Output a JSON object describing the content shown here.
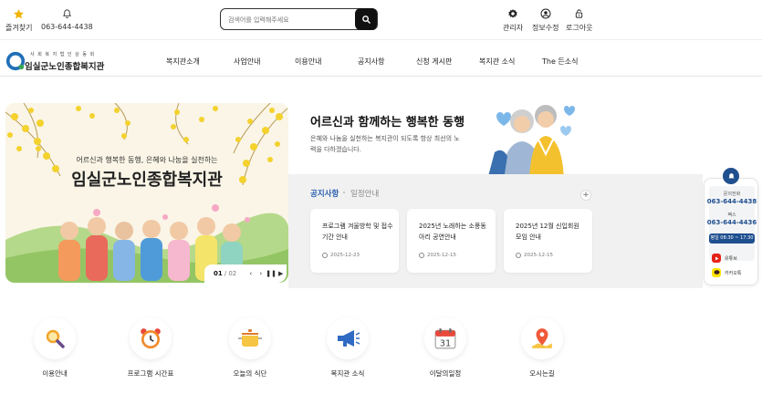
{
  "topbar": {
    "favorites_label": "즐겨찾기",
    "phone_label": "063-644-4438",
    "search_placeholder": "검색어를 입력해주세요",
    "admin_label": "관리자",
    "edit_info_label": "정보수정",
    "logout_label": "로그아웃"
  },
  "logo": {
    "small_text": "사 회 복 지 법 인 상 동 회",
    "name": "임실군노인종합복지관"
  },
  "nav": {
    "items": [
      "복지관소개",
      "사업안내",
      "이용안내",
      "공지사항",
      "신청 게시판",
      "복지관 소식",
      "The 든소식"
    ]
  },
  "hero": {
    "banner_caption": "어르신과 행복한 동행, 은혜와 나눔을 실천하는",
    "banner_title": "임실군노인종합복지관",
    "slide_current": "01",
    "slide_total": "/ 02",
    "intro_title": "어르신과 함께하는 행복한 동행",
    "intro_sub": "은혜와 나눔을 실천하는 복지관이 되도록 항상 최선의 노력을 다하겠습니다."
  },
  "notices": {
    "tab_active": "공지사항",
    "tab_inactive": "일정안내",
    "more_label": "+",
    "items": [
      {
        "title": "프로그램 겨울방학 및 접수기간 안내",
        "date": "2025-12-23"
      },
      {
        "title": "2025년 노래하는 소풍동아리 공연안내",
        "date": "2025-12-15"
      },
      {
        "title": "2025년 12월 신입회원 모임 안내",
        "date": "2025-12-15"
      }
    ]
  },
  "widget": {
    "contact_label": "문의전화",
    "contact_phone": "063-644-4438",
    "fax_label": "팩스",
    "fax_number": "063-644-4436",
    "hours": "평일 08:30 ~ 17:30",
    "youtube_label": "유튜브",
    "kakao_label": "카카오톡"
  },
  "quick_menu": {
    "items": [
      {
        "label": "이용안내",
        "icon": "magnifier-icon"
      },
      {
        "label": "프로그램 시간표",
        "icon": "alarm-clock-icon"
      },
      {
        "label": "오늘의 식단",
        "icon": "pot-icon"
      },
      {
        "label": "복지관 소식",
        "icon": "megaphone-icon"
      },
      {
        "label": "이달의일정",
        "icon": "calendar-icon"
      },
      {
        "label": "오시는길",
        "icon": "map-pin-icon"
      }
    ]
  },
  "colors": {
    "accent_blue": "#1f4f8f",
    "tab_blue": "#2a5fb0",
    "star_yellow": "#f2b400"
  }
}
